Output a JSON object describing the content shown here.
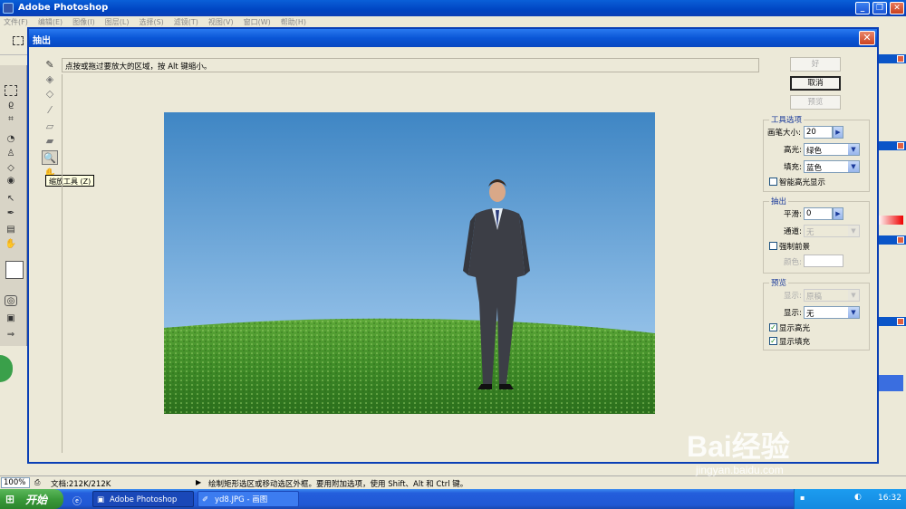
{
  "app": {
    "title": "Adobe Photoshop"
  },
  "menu": {
    "items": [
      "文件(F)",
      "编辑(E)",
      "图像(I)",
      "图层(L)",
      "选择(S)",
      "滤镜(T)",
      "视图(V)",
      "窗口(W)",
      "帮助(H)"
    ]
  },
  "dialog": {
    "title": "抽出",
    "hint": "点按或拖过要放大的区域，按 Alt 键缩小。",
    "tooltip": "缩放工具 (Z)",
    "tools": [
      "edge-highlighter-icon",
      "fill-icon",
      "eraser-icon",
      "eyedropper-icon",
      "cleanup-icon",
      "edge-touchup-icon",
      "zoom-icon",
      "hand-icon"
    ],
    "buttons": {
      "ok": "好",
      "cancel": "取消",
      "preview": "预览"
    },
    "tool_options": {
      "title": "工具选项",
      "brush_size_label": "画笔大小:",
      "brush_size": "20",
      "highlight_label": "高光:",
      "highlight_value": "绿色",
      "fill_label": "填充:",
      "fill_value": "蓝色",
      "smart_highlight_label": "智能高光显示",
      "smart_highlight_checked": false
    },
    "extraction": {
      "title": "抽出",
      "smooth_label": "平滑:",
      "smooth_value": "0",
      "channel_label": "通道:",
      "channel_value": "无",
      "force_fg_label": "强制前景",
      "force_fg_checked": false,
      "color_label": "颜色:"
    },
    "preview_group": {
      "title": "预览",
      "show1_label": "显示:",
      "show1_value": "原稿",
      "show2_label": "显示:",
      "show2_value": "无",
      "show_highlight_label": "显示高光",
      "show_highlight_checked": true,
      "show_fill_label": "显示填充",
      "show_fill_checked": true
    }
  },
  "status": {
    "zoom": "100%",
    "doc": "文档:212K/212K",
    "message": "绘制矩形选区或移动选区外框。要用附加选项，使用 Shift、Alt 和 Ctrl 键。"
  },
  "taskbar": {
    "start": "开始",
    "tasks": [
      "Adobe Photoshop",
      "yd8.JPG - 画图"
    ],
    "time": "16:32"
  },
  "watermark": {
    "text": "Bai经验",
    "url": "jingyan.baidu.com"
  },
  "colors": {
    "sky_top": "#4a8cc8",
    "sky_bottom": "#a8c8e8",
    "grass": "#3a8a2a",
    "xp_blue": "#0a56d6"
  }
}
